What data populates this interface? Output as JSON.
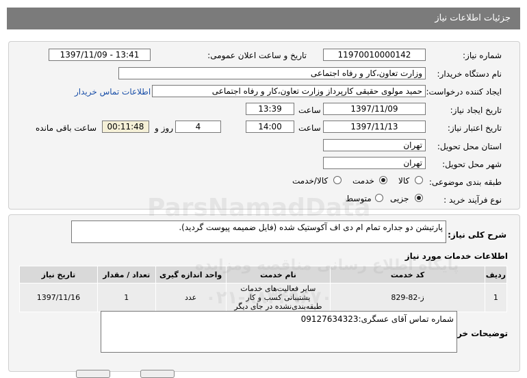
{
  "header": {
    "title": "جزئیات اطلاعات نیاز"
  },
  "fields": {
    "need_number_label": "شماره نیاز:",
    "need_number": "1197001000014‌2",
    "announce_label": "تاریخ و ساعت اعلان عمومی:",
    "announce_value": "1397/11/09 - 13:41",
    "buyer_org_label": "نام دستگاه خریدار:",
    "buyer_org": "وزارت تعاون،کار و رفاه اجتماعی",
    "creator_label": "ایجاد کننده درخواست:",
    "creator": "حمید  مولوی حقیقی کارپرداز وزارت تعاون،کار و رفاه اجتماعی",
    "contact_link": "اطلاعات تماس خریدار",
    "created_date_label": "تاریخ ایجاد نیاز:",
    "created_date": "1397/11/09",
    "time_label": "ساعت",
    "created_time": "13:39",
    "validity_label": "تاریخ اعتبار نیاز:",
    "validity_date": "1397/11/13",
    "validity_time": "14:00",
    "days_value": "4",
    "days_label": "روز و",
    "remaining_value": "00:11:48",
    "remaining_label": "ساعت باقی مانده",
    "province_label": "استان محل تحویل:",
    "province": "تهران",
    "city_label": "شهر محل تحویل:",
    "city": "تهران",
    "category_label": "طبقه بندی موضوعی:",
    "category_options": [
      "کالا",
      "خدمت",
      "کالا/خدمت"
    ],
    "category_selected": "خدمت",
    "process_label": "نوع فرآیند خرید :",
    "process_options": [
      "جزیی",
      "متوسط"
    ],
    "process_selected": "جزیی"
  },
  "description": {
    "label": "شرح کلی نیاز:",
    "text": "پارتیشن دو جداره تمام ام دی اف آکوستیک شده   (فایل ضمیمه پیوست گردید)."
  },
  "services": {
    "section_title": "اطلاعات خدمات مورد نیاز",
    "columns": [
      "ردیف",
      "کد خدمت",
      "نام خدمت",
      "واحد اندازه گیری",
      "تعداد / مقدار",
      "تاریخ نیاز"
    ],
    "rows": [
      {
        "row": "1",
        "code": "ز-82-829",
        "name_line1": "سایر فعالیت‌های خدمات پشتیبانی کسب و کار",
        "name_line2": "طبقه‌بندی‌نشده در جای دیگر",
        "unit": "عدد",
        "qty": "1",
        "date": "1397/11/16"
      }
    ]
  },
  "buyer_notes": {
    "label": "توضیحات خریدار:",
    "text": "شماره تماس آقای عسگری:09127634323"
  },
  "watermark": {
    "brand": "ParsNamadData",
    "line1": "پایگاه اطلاع رسانی مناقصه ومزایده",
    "line2": "۰۲۱-۸۸۳۴۹۶۷۰"
  }
}
